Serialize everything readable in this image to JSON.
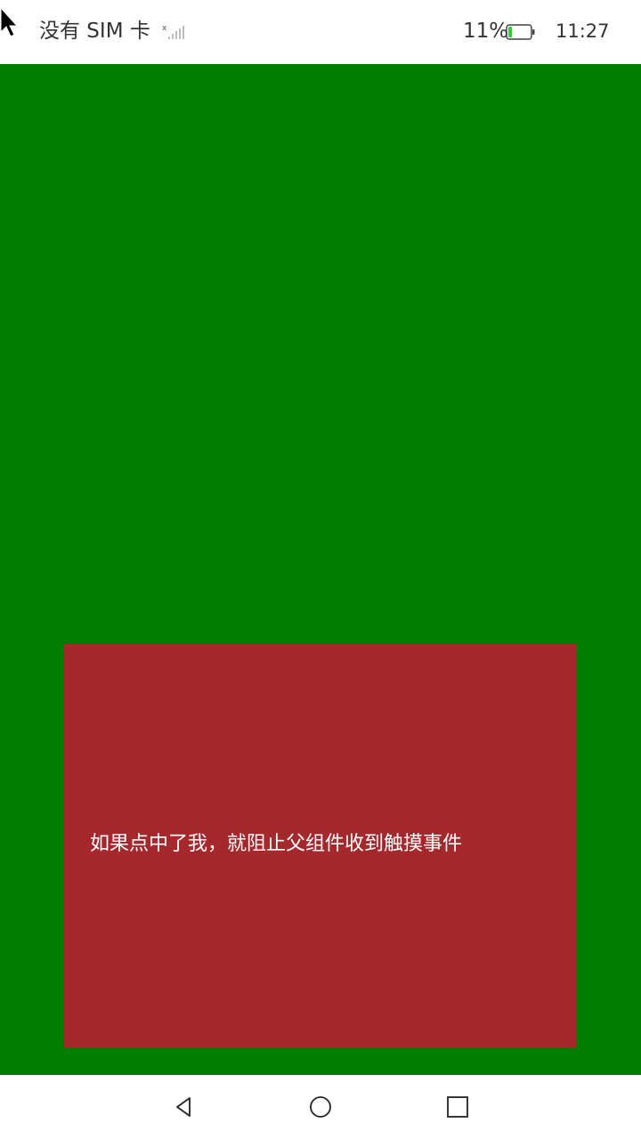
{
  "status_bar": {
    "carrier": "没有 SIM 卡",
    "battery_percent": "11%",
    "time": "11:27"
  },
  "main": {
    "parent_color": "#007c00",
    "child_color": "#a5282c",
    "child_text": "如果点中了我，就阻止父组件收到触摸事件"
  },
  "nav_bar": {
    "back_icon": "back-triangle-icon",
    "home_icon": "home-circle-icon",
    "recent_icon": "recent-square-icon"
  }
}
